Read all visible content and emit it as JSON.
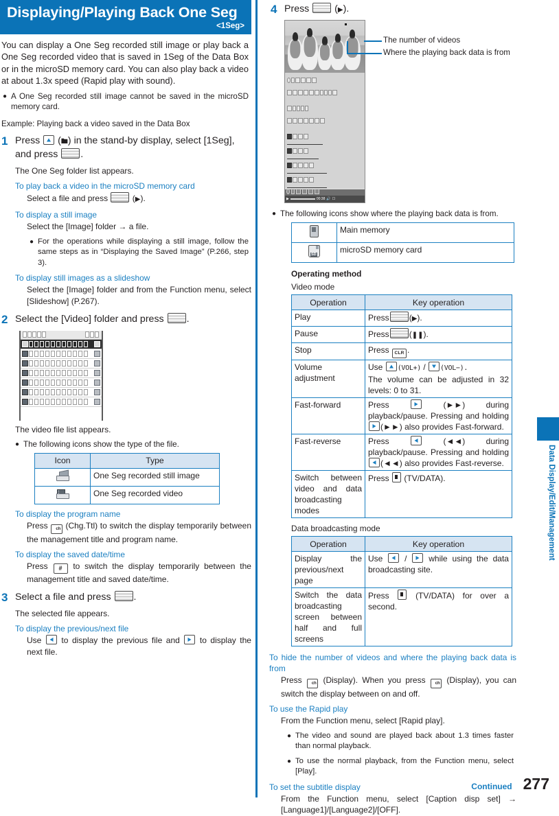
{
  "header": {
    "title": "Displaying/Playing Back One Seg",
    "subtitle": "<1Seg>",
    "bar_color": "#0b73b7"
  },
  "intro": {
    "paragraph": "You can display a One Seg recorded still image or play back a One Seg recorded video that is saved in 1Seg of the Data Box or in the microSD memory card. You can also play back a video at about 1.3x speed (Rapid play with sound).",
    "note": "A One Seg recorded still image cannot be saved in the microSD memory card.",
    "example": "Example: Playing back a video saved in the Data Box"
  },
  "steps": [
    {
      "number": "1",
      "title_a": "Press",
      "title_b": "(",
      "title_c": ") in the stand-by display, select [1Seg], and press",
      "title_d": ".",
      "result": "The One Seg folder list appears.",
      "subsections": [
        {
          "heading": "To play back a video in the microSD memory card",
          "body_a": "Select a file and press",
          "body_b": "(",
          "body_c": ")."
        },
        {
          "heading": "To display a still image",
          "body_a": "Select the [Image] folder → a file.",
          "bullet": "For the operations while displaying a still image, follow the same steps as in “Displaying the Saved Image” (P.266, step 3)."
        },
        {
          "heading": "To display still images as a slideshow",
          "body_a": "Select the [Image] folder and from the Function menu, select [Slideshow] (P.267)."
        }
      ]
    },
    {
      "number": "2",
      "title_a": "Select the [Video] folder and press",
      "title_d": ".",
      "result": "The video file list appears.",
      "bullet": "The following icons show the type of the file.",
      "icon_table": {
        "headers": [
          "Icon",
          "Type"
        ],
        "rows": [
          {
            "icon": "one-seg-still-image-icon",
            "type": "One Seg recorded still image"
          },
          {
            "icon": "one-seg-video-icon",
            "type": "One Seg recorded video"
          }
        ]
      },
      "subsections": [
        {
          "heading": "To display the program name",
          "body_a": "Press",
          "body_b": "(Chg.Ttl) to switch the display temporarily between the management title and program name."
        },
        {
          "heading": "To display the saved date/time",
          "body_a": "Press",
          "body_b": "to switch the display temporarily between the management title and saved date/time."
        }
      ]
    },
    {
      "number": "3",
      "title_a": "Select a file and press",
      "title_d": ".",
      "result": "The selected file appears.",
      "subsections": [
        {
          "heading": "To display the previous/next file",
          "body_a": "Use",
          "body_b": "to display the previous file and",
          "body_c": "to display the next file."
        }
      ]
    },
    {
      "number": "4",
      "title_a": "Press",
      "title_b": "(",
      "title_c": ").",
      "callouts": [
        "The number of videos",
        "Where the playing back data is from"
      ],
      "bullet": "The following icons show where the playing back data is from.",
      "memory_table": {
        "rows": [
          {
            "icon": "main-memory-icon",
            "label": "Main memory"
          },
          {
            "icon": "microsd-card-icon",
            "label": "microSD memory card"
          }
        ]
      }
    }
  ],
  "operating_method": {
    "caption": "Operating method",
    "video_mode": {
      "label": "Video mode",
      "headers": [
        "Operation",
        "Key operation"
      ],
      "rows": [
        {
          "operation": "Play",
          "key_pre": "Press",
          "key_mid": "(",
          "key_post": ").",
          "glyph": "►"
        },
        {
          "operation": "Pause",
          "key_pre": "Press",
          "key_mid": "(",
          "key_post": ").",
          "glyph": "❙❙"
        },
        {
          "operation": "Stop",
          "key_pre": "Press",
          "key_label": "CLR",
          "key_post": "."
        },
        {
          "operation": "Volume adjustment",
          "key_pre": "Use",
          "key_vol_plus": "(VOL+)",
          "key_sep": "/",
          "key_vol_minus": "(VOL−).",
          "key_extra": "The volume can be adjusted in 32 levels: 0 to 31."
        },
        {
          "operation": "Fast-forward",
          "key_pre": "Press",
          "key_mid": "(►►) during playback/pause. Pressing and holding",
          "key_mid2": "(►►)",
          "key_post": "also provides Fast-forward."
        },
        {
          "operation": "Fast-reverse",
          "key_pre": "Press",
          "key_mid": "(◄◄) during playback/pause. Pressing and holding",
          "key_mid2": "(◄◄)",
          "key_post": "also provides Fast-reverse."
        },
        {
          "operation": "Switch between video and data broadcasting modes",
          "key_pre": "Press",
          "key_post": "(TV/DATA)."
        }
      ]
    },
    "data_mode": {
      "label": "Data broadcasting mode",
      "headers": [
        "Operation",
        "Key operation"
      ],
      "rows": [
        {
          "operation": "Display the previous/next page",
          "key_pre": "Use",
          "key_sep": "/",
          "key_post": "while using the data broadcasting site."
        },
        {
          "operation": "Switch the data broadcasting screen between half and full screens",
          "key_pre": "Press",
          "key_post": "(TV/DATA) for over a second."
        }
      ]
    }
  },
  "tips": [
    {
      "heading": "To hide the number of videos and where the playing back data is from",
      "body_a": "Press",
      "body_b": "(Display). When you press",
      "body_c": "(Display), you can switch the display between on and off."
    },
    {
      "heading": "To use the Rapid play",
      "body_a": "From the Function menu, select [Rapid play].",
      "bullets": [
        "The video and sound are played back about 1.3 times faster than normal playback.",
        "To use the normal playback, from the Function menu, select [Play]."
      ]
    },
    {
      "heading": "To set the subtitle display",
      "body_a": "From the Function menu, select [Caption disp set] → [Language1]/[Language2]/[OFF]."
    }
  ],
  "side_tab": {
    "label": "Data Display/Edit/Management"
  },
  "footer": {
    "continued": "Continued",
    "page": "277"
  }
}
